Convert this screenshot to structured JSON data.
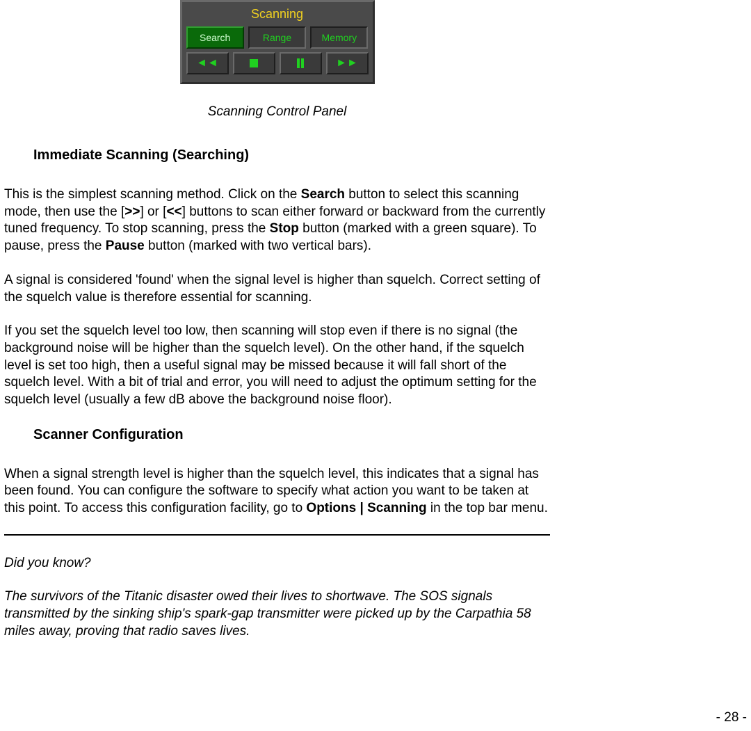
{
  "panel": {
    "title": "Scanning",
    "tabs": [
      "Search",
      "Range",
      "Memory"
    ]
  },
  "caption": "Scanning Control Panel",
  "h1": "Immediate Scanning (Searching)",
  "p1_a": "This is the simplest scanning method.  Click on the ",
  "p1_b": "Search",
  "p1_c": " button to select this scanning mode, then use the [",
  "p1_d": ">>",
  "p1_e": "] or [",
  "p1_f": "<<",
  "p1_g": "] buttons to scan either forward or backward from the currently tuned frequency. To stop scanning, press the ",
  "p1_h": "Stop",
  "p1_i": " button (marked with a green square). To pause, press the ",
  "p1_j": "Pause",
  "p1_k": " button (marked with two vertical bars).",
  "p2": "A signal is considered 'found' when the signal level is higher than squelch. Correct setting of the squelch value is therefore essential for scanning.",
  "p3": "If you set the squelch level too low, then scanning will stop even if there is no signal (the background noise will be higher than the squelch level). On the other hand, if the squelch level is set too high, then a useful signal may be missed because it will fall short of the squelch level. With a bit of trial and error, you will need to adjust the optimum setting for the squelch level (usually a few dB above the background noise floor).",
  "h2": "Scanner Configuration",
  "p4_a": "When a signal strength level is higher than the squelch level, this indicates that a signal has been found. You can configure the software to specify what action you want to be taken at this point. To access this configuration facility, go to ",
  "p4_b": "Options | Scanning",
  "p4_c": " in the top bar menu.",
  "dyk": "Did you know?",
  "trivia": "The survivors of the Titanic disaster owed their lives to shortwave. The SOS signals transmitted by the sinking ship's spark-gap transmitter were picked up by the Carpathia 58 miles away, proving that radio saves lives.",
  "pagenum": "- 28 -"
}
